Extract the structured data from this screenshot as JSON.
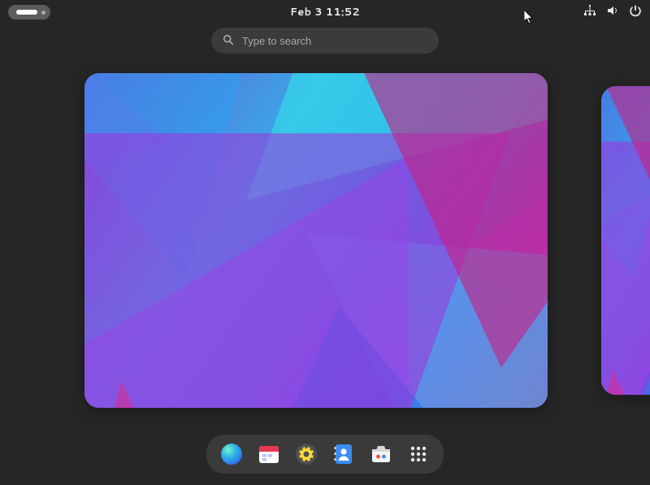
{
  "topbar": {
    "clock": "Feb 3  11:52",
    "tray": [
      {
        "name": "network-icon"
      },
      {
        "name": "volume-icon"
      },
      {
        "name": "power-icon"
      }
    ]
  },
  "search": {
    "placeholder": "Type to search",
    "value": ""
  },
  "workspaces": [
    {
      "name": "workspace-1",
      "active": true
    },
    {
      "name": "workspace-2",
      "active": false
    }
  ],
  "dock": {
    "items": [
      {
        "name": "web-browser",
        "label": "Web Browser"
      },
      {
        "name": "calendar",
        "label": "Calendar"
      },
      {
        "name": "settings",
        "label": "Settings"
      },
      {
        "name": "contacts",
        "label": "Contacts"
      },
      {
        "name": "software",
        "label": "Software"
      },
      {
        "name": "app-grid",
        "label": "Show Applications"
      }
    ]
  }
}
